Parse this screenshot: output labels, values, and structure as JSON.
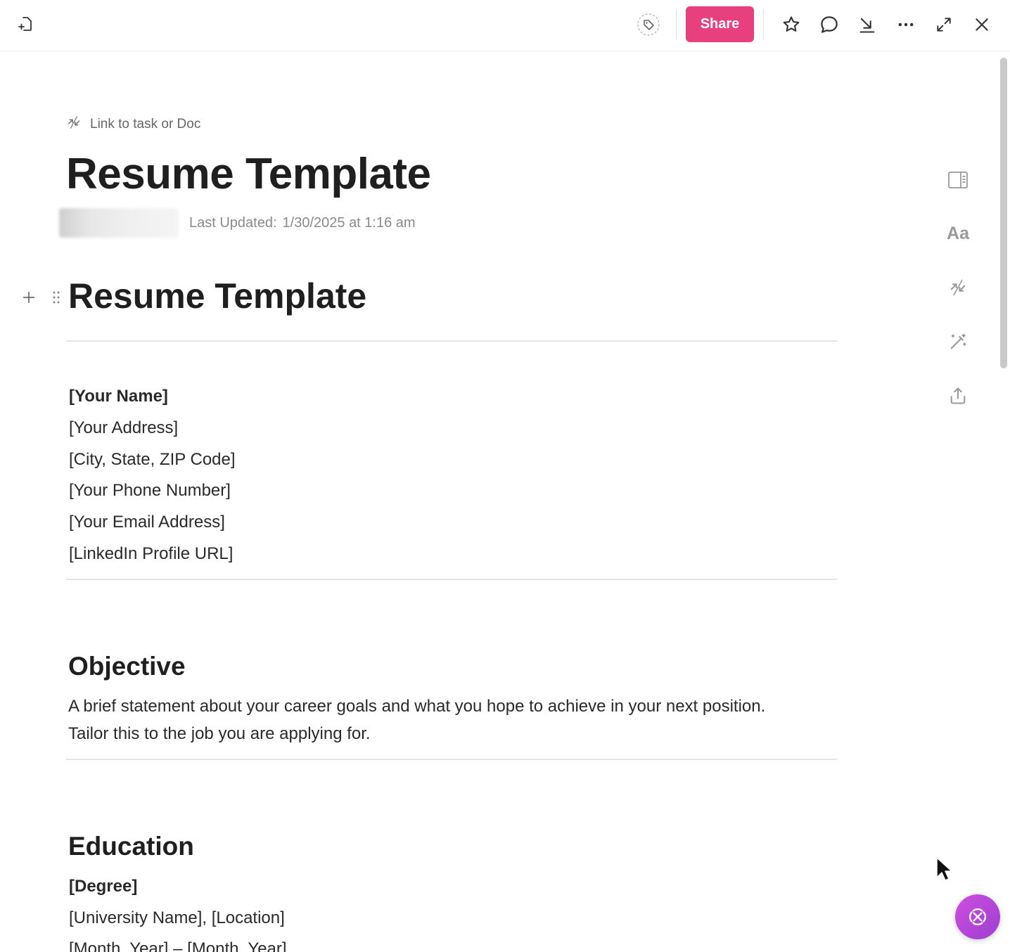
{
  "toolbar": {
    "share_label": "Share",
    "icons": [
      "new-doc-icon",
      "tag-icon",
      "star-icon",
      "comment-icon",
      "download-icon",
      "more-icon",
      "expand-icon",
      "close-icon"
    ]
  },
  "doc": {
    "link_label": "Link to task or Doc",
    "title": "Resume Template",
    "last_updated_label": "Last Updated:",
    "last_updated_value": "1/30/2025 at 1:16 am"
  },
  "content": {
    "h1": "Resume Template",
    "contact": {
      "name": "[Your Name]",
      "address": "[Your Address]",
      "city": "[City, State, ZIP Code]",
      "phone": "[Your Phone Number]",
      "email": "[Your Email Address]",
      "linkedin": "[LinkedIn Profile URL]"
    },
    "objective": {
      "heading": "Objective",
      "line1": "A brief statement about your career goals and what you hope to achieve in your next position.",
      "line2": "Tailor this to the job you are applying for."
    },
    "education": {
      "heading": "Education",
      "degree": "[Degree]",
      "university": "[University Name], [Location]",
      "dates": "[Month, Year] – [Month, Year]"
    }
  },
  "rail": {
    "text_icon_label": "Aa",
    "icons": [
      "sidebar-panel-icon",
      "typography-icon",
      "relationships-icon",
      "ai-wand-icon",
      "export-icon"
    ]
  },
  "colors": {
    "accent": "#e8407f",
    "ai_fab": "#b048d9"
  }
}
